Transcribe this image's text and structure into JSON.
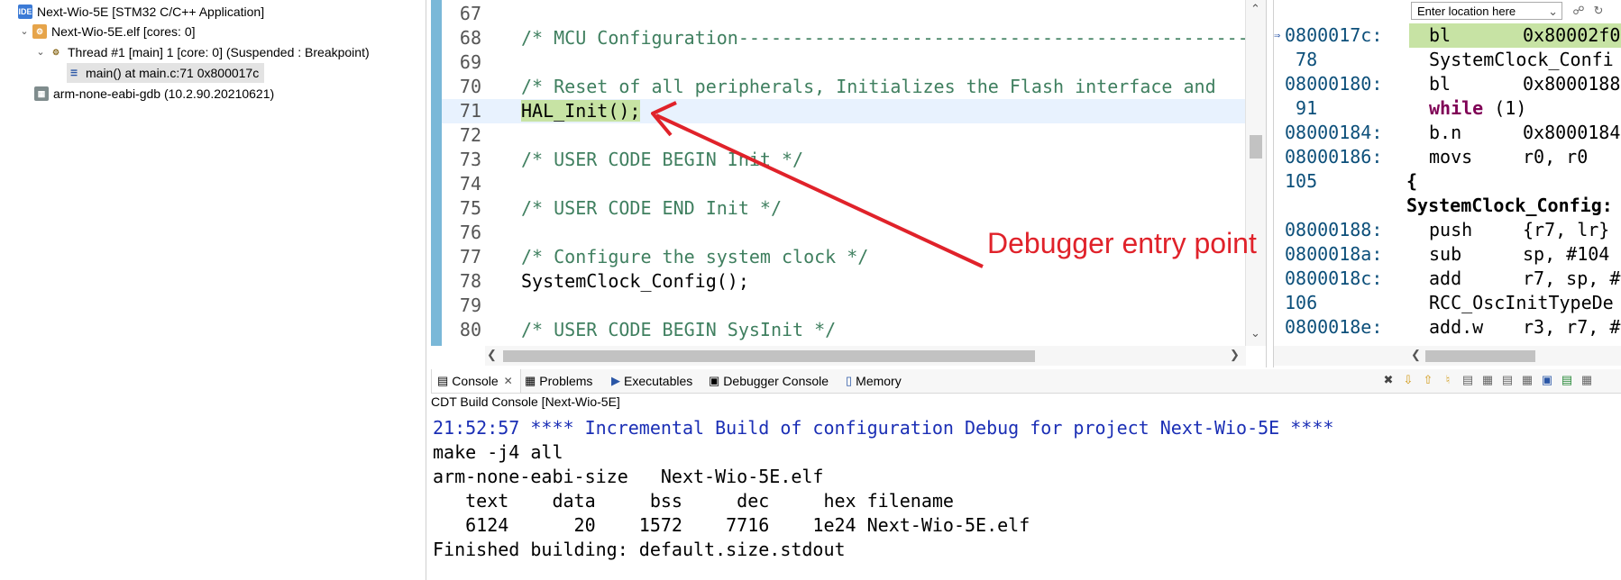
{
  "debug_tree": {
    "items": [
      {
        "label": "Next-Wio-5E [STM32 C/C++ Application]",
        "icon": "ide-icon",
        "twisty": ""
      },
      {
        "label": "Next-Wio-5E.elf [cores: 0]",
        "icon": "elf-icon",
        "twisty": "⌄"
      },
      {
        "label": "Thread #1 [main] 1 [core: 0] (Suspended : Breakpoint)",
        "icon": "thread-icon",
        "twisty": "⌄"
      },
      {
        "label": "main() at main.c:71 0x800017c",
        "icon": "stack-frame-icon",
        "twisty": ""
      },
      {
        "label": "arm-none-eabi-gdb (10.2.90.20210621)",
        "icon": "gdb-icon",
        "twisty": ""
      }
    ]
  },
  "editor": {
    "lines": [
      {
        "num": "67",
        "code": ""
      },
      {
        "num": "68",
        "code": "/* MCU Configuration--------------------------------------------------------",
        "comment": true
      },
      {
        "num": "69",
        "code": ""
      },
      {
        "num": "70",
        "code": "/* Reset of all peripherals, Initializes the Flash interface and",
        "comment": true
      },
      {
        "num": "71",
        "code": "HAL_Init();",
        "current": true
      },
      {
        "num": "72",
        "code": ""
      },
      {
        "num": "73",
        "code": "/* USER CODE BEGIN Init */",
        "comment": true
      },
      {
        "num": "74",
        "code": ""
      },
      {
        "num": "75",
        "code": "/* USER CODE END Init */",
        "comment": true
      },
      {
        "num": "76",
        "code": ""
      },
      {
        "num": "77",
        "code": "/* Configure the system clock */",
        "comment": true
      },
      {
        "num": "78",
        "code": "SystemClock_Config();"
      },
      {
        "num": "79",
        "code": ""
      },
      {
        "num": "80",
        "code": "/* USER CODE BEGIN SysInit */",
        "comment": true
      }
    ]
  },
  "annotation": {
    "text": "Debugger entry point",
    "color": "#e0222a"
  },
  "disassembly": {
    "location_placeholder": "Enter location here",
    "lines": [
      {
        "addr": "0800017c:",
        "mn": "bl",
        "op": "0x80002f0",
        "current": true
      },
      {
        "addr": " 78",
        "src": "SystemClock_Confi"
      },
      {
        "addr": "08000180:",
        "mn": "bl",
        "op": "0x8000188"
      },
      {
        "addr": " 91",
        "src_kw": "while",
        "src": " (1)"
      },
      {
        "addr": "08000184:",
        "mn": "b.n",
        "op": "0x8000184"
      },
      {
        "addr": "08000186:",
        "mn": "movs",
        "op": "r0, r0"
      },
      {
        "addr": "105",
        "func_open": "{"
      },
      {
        "func": "SystemClock_Config:"
      },
      {
        "addr": "08000188:",
        "mn": "push",
        "op": "{r7, lr}"
      },
      {
        "addr": "0800018a:",
        "mn": "sub",
        "op": "sp, #104"
      },
      {
        "addr": "0800018c:",
        "mn": "add",
        "op": "r7, sp, #"
      },
      {
        "addr": "106",
        "src": "RCC_OscInitTypeDe"
      },
      {
        "addr": "0800018e:",
        "mn": "add.w",
        "op": "r3, r7, #"
      }
    ]
  },
  "bottom_panel": {
    "tabs": [
      {
        "label": "Console",
        "icon": "console-icon",
        "active": true
      },
      {
        "label": "Problems",
        "icon": "problems-icon"
      },
      {
        "label": "Executables",
        "icon": "executables-icon"
      },
      {
        "label": "Debugger Console",
        "icon": "debugger-console-icon"
      },
      {
        "label": "Memory",
        "icon": "memory-icon"
      }
    ],
    "console_title": "CDT Build Console [Next-Wio-5E]",
    "console_lines": [
      {
        "text": "21:52:57 **** Incremental Build of configuration Debug for project Next-Wio-5E ****",
        "blue": true
      },
      {
        "text": "make -j4 all"
      },
      {
        "text": "arm-none-eabi-size   Next-Wio-5E.elf"
      },
      {
        "text": "   text    data     bss     dec     hex filename"
      },
      {
        "text": "   6124      20    1572    7716    1e24 Next-Wio-5E.elf"
      },
      {
        "text": "Finished building: default.size.stdout"
      }
    ]
  }
}
